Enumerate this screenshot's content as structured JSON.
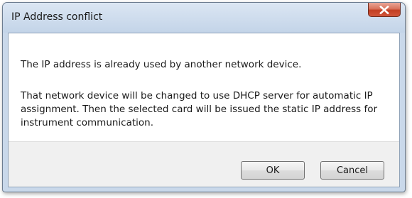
{
  "dialog": {
    "title": "IP Address conflict",
    "close_icon": "close-x-icon",
    "message_line1": "The IP address is already used by another network device.",
    "message_line2": "That network device will be changed to use DHCP server for automatic IP assignment. Then the selected card will be issued the static IP address for instrument communication.",
    "ok_label": "OK",
    "cancel_label": "Cancel"
  },
  "colors": {
    "title_bar": "#c9d8ea",
    "close_button": "#c33f23",
    "content_bg": "#ffffff",
    "footer_bg": "#f0f0f0"
  }
}
